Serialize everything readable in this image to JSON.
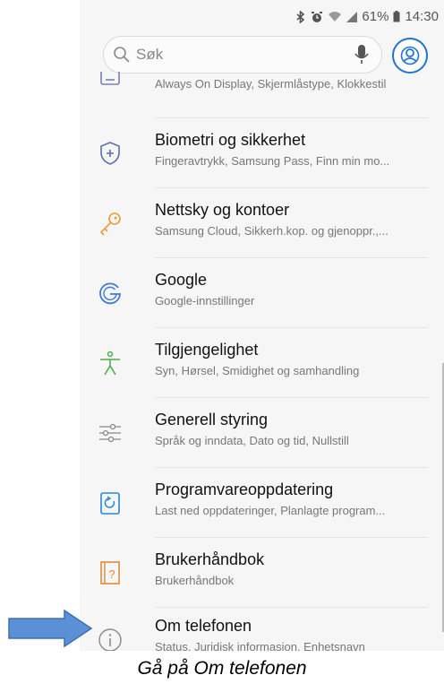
{
  "status_bar": {
    "battery": "61%",
    "time": "14:30",
    "icons": [
      "bluetooth-icon",
      "alarm-icon",
      "wifi-icon",
      "signal-icon",
      "battery-icon"
    ]
  },
  "search": {
    "placeholder": "Søk",
    "icons": [
      "search-icon",
      "microphone-icon"
    ]
  },
  "profile_icon": "account-icon",
  "settings": [
    {
      "title": "",
      "subtitle": "Always On Display, Skjermlåstype, Klokkestil",
      "icon": "lock-screen-icon",
      "color": "#7c7fb0"
    },
    {
      "title": "Biometri og sikkerhet",
      "subtitle": "Fingeravtrykk, Samsung Pass, Finn min mo...",
      "icon": "shield-icon",
      "color": "#5f6fa8"
    },
    {
      "title": "Nettsky og kontoer",
      "subtitle": "Samsung Cloud, Sikkerh.kop. og gjenoppr.,...",
      "icon": "key-icon",
      "color": "#e89a3c"
    },
    {
      "title": "Google",
      "subtitle": "Google-innstillinger",
      "icon": "google-icon",
      "color": "#3d7bd6"
    },
    {
      "title": "Tilgjengelighet",
      "subtitle": "Syn, Hørsel, Smidighet og samhandling",
      "icon": "accessibility-icon",
      "color": "#4cae4c"
    },
    {
      "title": "Generell styring",
      "subtitle": "Språk og inndata, Dato og tid, Nullstill",
      "icon": "sliders-icon",
      "color": "#8a8a8a"
    },
    {
      "title": "Programvareoppdatering",
      "subtitle": "Last ned oppdateringer, Planlagte program...",
      "icon": "software-update-icon",
      "color": "#2a86d6"
    },
    {
      "title": "Brukerhåndbok",
      "subtitle": "Brukerhåndbok",
      "icon": "manual-icon",
      "color": "#e08a3a"
    },
    {
      "title": "Om telefonen",
      "subtitle": "Status, Juridisk informasjon, Enhetsnavn",
      "icon": "info-icon",
      "color": "#8a8a8a"
    }
  ],
  "caption": "Gå på Om telefonen",
  "arrow": {
    "icon": "arrow-right-icon",
    "color": "#5b8fd6"
  }
}
